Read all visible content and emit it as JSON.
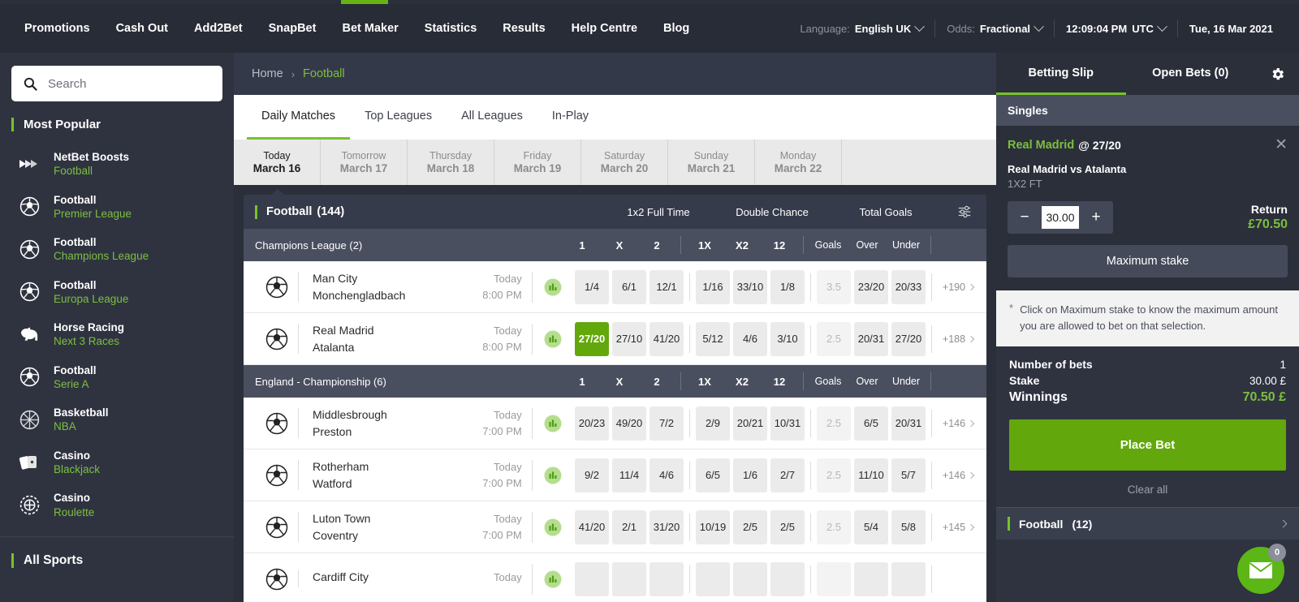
{
  "header": {
    "nav": [
      "Promotions",
      "Cash Out",
      "Add2Bet",
      "SnapBet",
      "Bet Maker",
      "Statistics",
      "Results",
      "Help Centre",
      "Blog"
    ],
    "language_label": "Language:",
    "language_value": "English UK",
    "odds_label": "Odds:",
    "odds_value": "Fractional",
    "time": "12:09:04 PM",
    "timezone": "UTC",
    "date": "Tue, 16 Mar 2021"
  },
  "sidebar": {
    "search_placeholder": "Search",
    "most_popular": "Most Popular",
    "all_sports": "All Sports",
    "items": [
      {
        "icon": "boosts-icon",
        "title": "NetBet Boosts",
        "sub": "Football"
      },
      {
        "icon": "football-icon",
        "title": "Football",
        "sub": "Premier League"
      },
      {
        "icon": "football-icon",
        "title": "Football",
        "sub": "Champions League"
      },
      {
        "icon": "football-icon",
        "title": "Football",
        "sub": "Europa League"
      },
      {
        "icon": "horse-icon",
        "title": "Horse Racing",
        "sub": "Next 3 Races"
      },
      {
        "icon": "football-icon",
        "title": "Football",
        "sub": "Serie A"
      },
      {
        "icon": "basketball-icon",
        "title": "Basketball",
        "sub": "NBA"
      },
      {
        "icon": "cards-icon",
        "title": "Casino",
        "sub": "Blackjack"
      },
      {
        "icon": "chip-icon",
        "title": "Casino",
        "sub": "Roulette"
      }
    ]
  },
  "main": {
    "breadcrumb": {
      "home": "Home",
      "sep": "›",
      "current": "Football"
    },
    "tabs": [
      {
        "label": "Daily Matches",
        "active": true
      },
      {
        "label": "Top Leagues",
        "active": false
      },
      {
        "label": "All Leagues",
        "active": false
      },
      {
        "label": "In-Play",
        "active": false
      }
    ],
    "days": [
      {
        "day": "Today",
        "date": "March 16",
        "active": true
      },
      {
        "day": "Tomorrow",
        "date": "March 17",
        "active": false
      },
      {
        "day": "Thursday",
        "date": "March 18",
        "active": false
      },
      {
        "day": "Friday",
        "date": "March 19",
        "active": false
      },
      {
        "day": "Saturday",
        "date": "March 20",
        "active": false
      },
      {
        "day": "Sunday",
        "date": "March 21",
        "active": false
      },
      {
        "day": "Monday",
        "date": "March 22",
        "active": false
      }
    ],
    "sport_header": {
      "name": "Football",
      "count": "(144)",
      "markets": [
        "1x2 Full Time",
        "Double Chance",
        "Total Goals"
      ]
    },
    "columns": [
      "1",
      "X",
      "2",
      "1X",
      "X2",
      "12",
      "Goals",
      "Over",
      "Under"
    ],
    "leagues": [
      {
        "name": "Champions League (2)",
        "matches": [
          {
            "home": "Man City",
            "away": "Monchengladbach",
            "day": "Today",
            "time": "8:00 PM",
            "odds": [
              "1/4",
              "6/1",
              "12/1",
              "1/16",
              "33/10",
              "1/8",
              "3.5",
              "23/20",
              "20/33"
            ],
            "line_index": 6,
            "selected_index": -1,
            "more": "+190"
          },
          {
            "home": "Real Madrid",
            "away": "Atalanta",
            "day": "Today",
            "time": "8:00 PM",
            "odds": [
              "27/20",
              "27/10",
              "41/20",
              "5/12",
              "4/6",
              "3/10",
              "2.5",
              "20/31",
              "27/20"
            ],
            "line_index": 6,
            "selected_index": 0,
            "more": "+188"
          }
        ]
      },
      {
        "name": "England - Championship (6)",
        "matches": [
          {
            "home": "Middlesbrough",
            "away": "Preston",
            "day": "Today",
            "time": "7:00 PM",
            "odds": [
              "20/23",
              "49/20",
              "7/2",
              "2/9",
              "20/21",
              "10/31",
              "2.5",
              "6/5",
              "20/31"
            ],
            "line_index": 6,
            "selected_index": -1,
            "more": "+146"
          },
          {
            "home": "Rotherham",
            "away": "Watford",
            "day": "Today",
            "time": "7:00 PM",
            "odds": [
              "9/2",
              "11/4",
              "4/6",
              "6/5",
              "1/6",
              "2/7",
              "2.5",
              "11/10",
              "5/7"
            ],
            "line_index": 6,
            "selected_index": -1,
            "more": "+146"
          },
          {
            "home": "Luton Town",
            "away": "Coventry",
            "day": "Today",
            "time": "7:00 PM",
            "odds": [
              "41/20",
              "2/1",
              "31/20",
              "10/19",
              "2/5",
              "2/5",
              "2.5",
              "5/4",
              "5/8"
            ],
            "line_index": 6,
            "selected_index": -1,
            "more": "+145"
          },
          {
            "home": "Cardiff City",
            "away": "",
            "day": "Today",
            "time": "",
            "odds": [
              "",
              "",
              "",
              "",
              "",
              "",
              "",
              "",
              ""
            ],
            "line_index": 6,
            "selected_index": -1,
            "more": ""
          }
        ]
      }
    ]
  },
  "slip": {
    "tabs": [
      {
        "label": "Betting Slip",
        "active": true
      },
      {
        "label": "Open Bets (0)",
        "active": false
      }
    ],
    "singles": "Singles",
    "selection": {
      "name": "Real Madrid",
      "at": "@ 27/20",
      "match": "Real Madrid vs Atalanta",
      "market": "1X2 FT",
      "close": "✕"
    },
    "stake_value": "30.00",
    "minus": "−",
    "plus": "+",
    "return_label": "Return",
    "return_value": "£70.50",
    "max_stake": "Maximum stake",
    "note_star": "*",
    "note": "Click on Maximum stake to know the maximum amount you are allowed to bet on that selection.",
    "totals": [
      {
        "label": "Number of bets",
        "value": "1"
      },
      {
        "label": "Stake",
        "value": "30.00 £"
      }
    ],
    "winnings_label": "Winnings",
    "winnings_value": "70.50 £",
    "place_bet": "Place Bet",
    "clear_all": "Clear all",
    "footer": {
      "label": "Football",
      "count": "(12)"
    },
    "chat_badge": "0"
  },
  "colors": {
    "green": "#76c32a",
    "green_dark": "#62a80c",
    "dark_bg": "#2b2f3a",
    "panel": "#2f3340",
    "header_row": "#4a4f60"
  }
}
